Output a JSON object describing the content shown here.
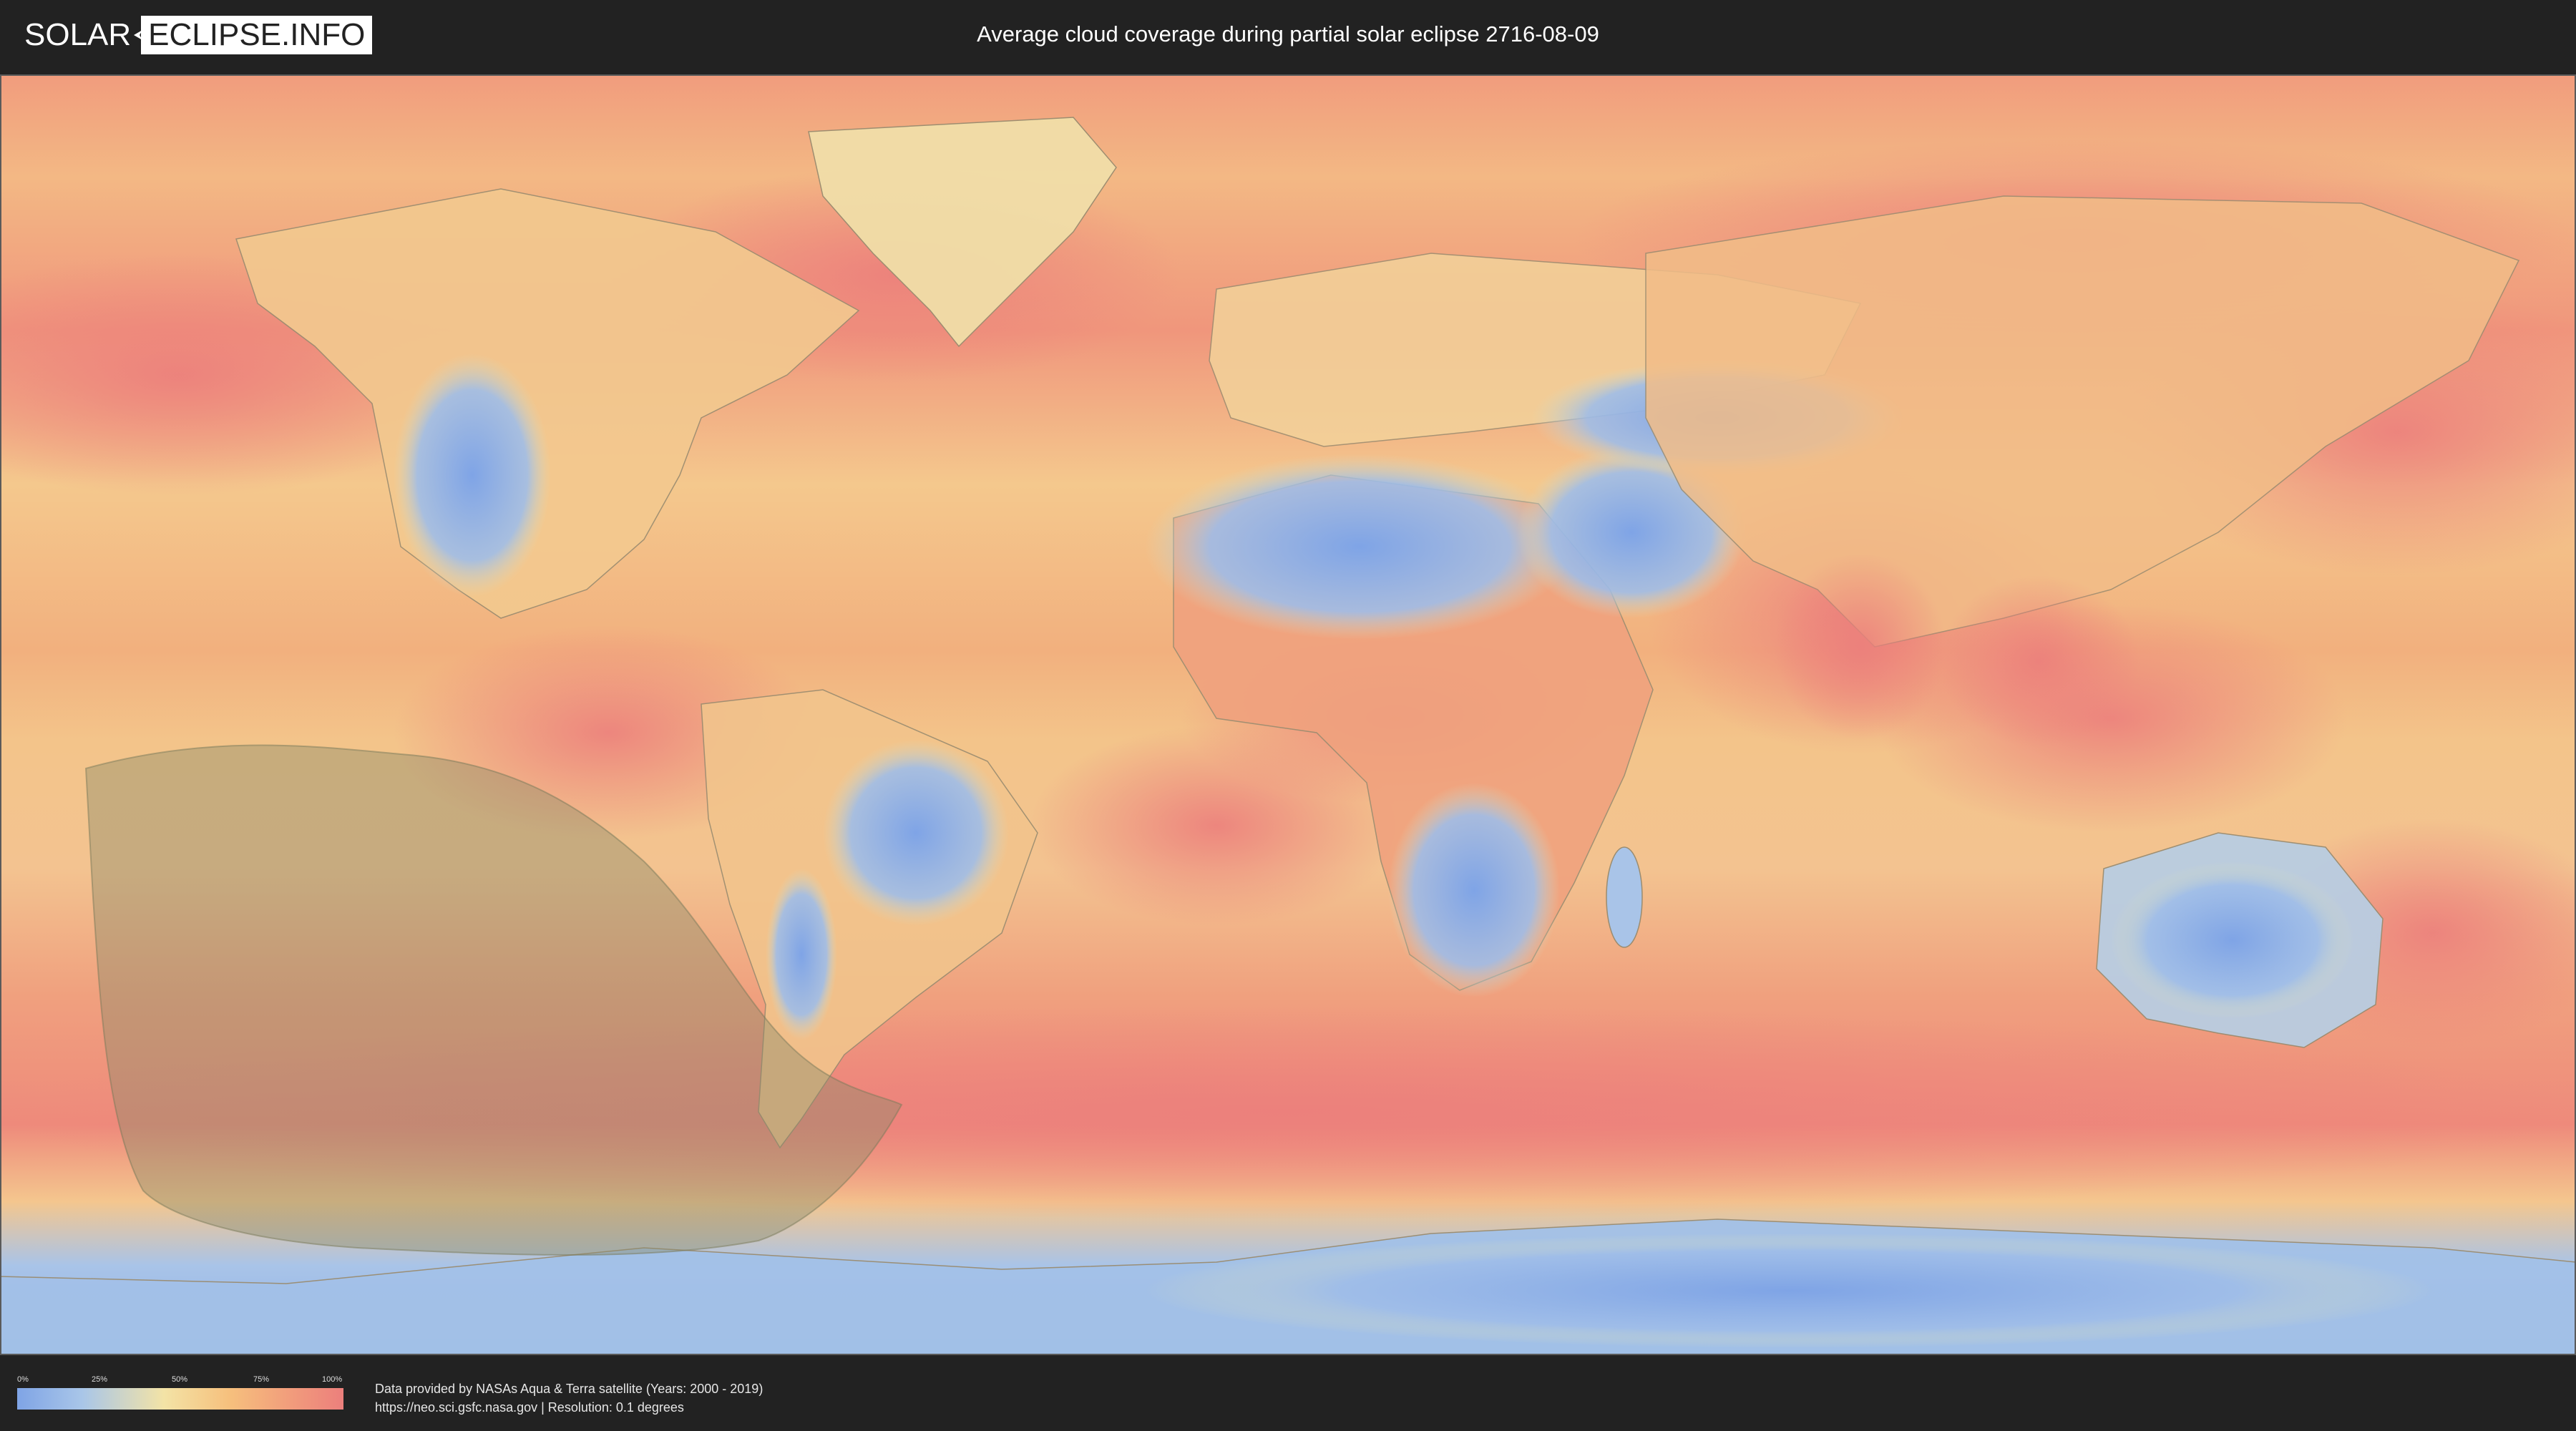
{
  "header": {
    "logo_part1": "SOLAR",
    "logo_part2": "ECLIPSE.INFO",
    "title": "Average cloud coverage during partial solar eclipse 2716-08-09"
  },
  "legend": {
    "ticks": [
      "0%",
      "25%",
      "50%",
      "75%",
      "100%"
    ],
    "colors": {
      "low": "#7fa4e6",
      "mid_low": "#a9c6e8",
      "mid": "#f3e3a6",
      "mid_high": "#f6c07d",
      "high": "#ec7f7c"
    }
  },
  "footer": {
    "credit_line1": "Data provided by NASAs Aqua & Terra satellite (Years: 2000 - 2019)",
    "credit_line2": "https://neo.sci.gsfc.nasa.gov | Resolution: 0.1 degrees"
  },
  "map": {
    "projection": "equirectangular",
    "eclipse_zone_color": "#8a8a6a",
    "ocean_base_color": "#f2b47a"
  }
}
